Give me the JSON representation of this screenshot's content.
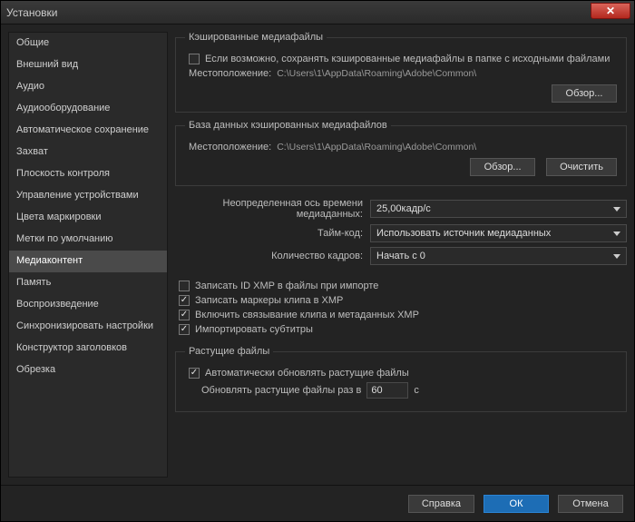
{
  "window": {
    "title": "Установки"
  },
  "sidebar": {
    "items": [
      {
        "label": "Общие"
      },
      {
        "label": "Внешний вид"
      },
      {
        "label": "Аудио"
      },
      {
        "label": "Аудиооборудование"
      },
      {
        "label": "Автоматическое сохранение"
      },
      {
        "label": "Захват"
      },
      {
        "label": "Плоскость контроля"
      },
      {
        "label": "Управление устройствами"
      },
      {
        "label": "Цвета маркировки"
      },
      {
        "label": "Метки по умолчанию"
      },
      {
        "label": "Медиаконтент"
      },
      {
        "label": "Память"
      },
      {
        "label": "Воспроизведение"
      },
      {
        "label": "Синхронизировать настройки"
      },
      {
        "label": "Конструктор заголовков"
      },
      {
        "label": "Обрезка"
      }
    ],
    "selected_index": 10
  },
  "cache_group": {
    "legend": "Кэшированные медиафайлы",
    "save_checkbox_label": "Если возможно, сохранять кэшированные медиафайлы в папке с исходными файлами",
    "save_checked": false,
    "location_label": "Местоположение:",
    "location_value": "C:\\Users\\1\\AppData\\Roaming\\Adobe\\Common\\",
    "browse_button": "Обзор..."
  },
  "db_group": {
    "legend": "База данных кэшированных медиафайлов",
    "location_label": "Местоположение:",
    "location_value": "C:\\Users\\1\\AppData\\Roaming\\Adobe\\Common\\",
    "browse_button": "Обзор...",
    "clean_button": "Очистить"
  },
  "form": {
    "timebase_label": "Неопределенная ось времени медиаданных:",
    "timebase_value": "25,00кадр/с",
    "timecode_label": "Тайм-код:",
    "timecode_value": "Использовать источник медиаданных",
    "frames_label": "Количество кадров:",
    "frames_value": "Начать с 0"
  },
  "checks": {
    "write_xmp": {
      "label": "Записать ID XMP в файлы при импорте",
      "checked": false
    },
    "write_markers": {
      "label": "Записать маркеры клипа в XMP",
      "checked": true
    },
    "link_meta": {
      "label": "Включить связывание клипа и метаданных XMP",
      "checked": true
    },
    "import_subs": {
      "label": "Импортировать субтитры",
      "checked": true
    }
  },
  "growing_group": {
    "legend": "Растущие файлы",
    "auto_label": "Автоматически обновлять растущие файлы",
    "auto_checked": true,
    "interval_prefix": "Обновлять растущие файлы раз в",
    "interval_value": "60",
    "interval_suffix": "с"
  },
  "footer": {
    "help": "Справка",
    "ok": "ОК",
    "cancel": "Отмена"
  }
}
